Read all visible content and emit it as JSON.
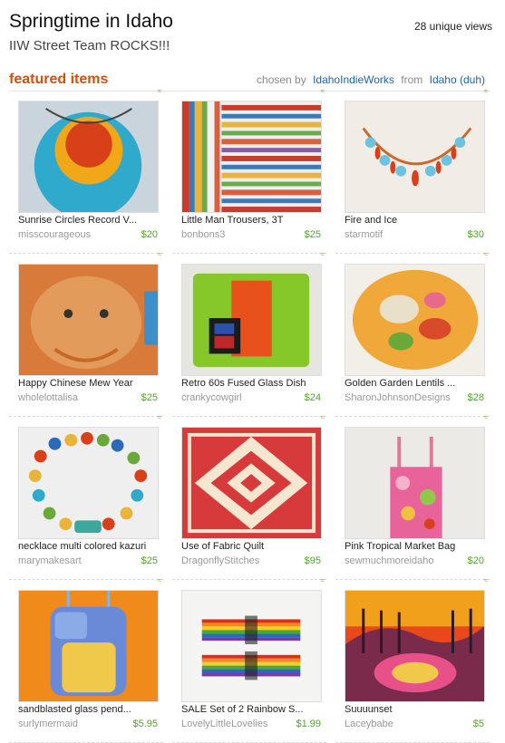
{
  "header": {
    "title": "Springtime in Idaho",
    "views": "28 unique views",
    "subtitle": "IIW Street Team ROCKS!!!"
  },
  "featured": {
    "label": "featured items",
    "chosen_by_prefix": "chosen by",
    "curator": "IdahoIndieWorks",
    "from_prefix": "from",
    "location": "Idaho (duh)"
  },
  "colors": {
    "accent": "#d54e0e",
    "link": "#1d63a6",
    "price": "#55a32a"
  },
  "items": [
    {
      "title": "Sunrise Circles  Record V...",
      "seller": "misscourageous",
      "price": "$20",
      "image": "orange-circle-on-teal-necklace"
    },
    {
      "title": "Little Man Trousers, 3T",
      "seller": "bonbons3",
      "price": "$25",
      "image": "striped-fabric"
    },
    {
      "title": "Fire and Ice",
      "seller": "starmotif",
      "price": "$30",
      "image": "bead-necklace"
    },
    {
      "title": "Happy Chinese Mew Year",
      "seller": "wholelottalisa",
      "price": "$25",
      "image": "knitted-cat"
    },
    {
      "title": "Retro 60s Fused Glass Dish",
      "seller": "crankycowgirl",
      "price": "$24",
      "image": "fused-glass-dish"
    },
    {
      "title": "Golden Garden Lentils ...",
      "seller": "SharonJohnsonDesigns",
      "price": "$28",
      "image": "lentil-bead"
    },
    {
      "title": "necklace multi colored kazuri",
      "seller": "marymakesart",
      "price": "$25",
      "image": "kazuri-bead-necklace"
    },
    {
      "title": "Use of Fabric Quilt",
      "seller": "DragonflyStitches",
      "price": "$95",
      "image": "red-quilt"
    },
    {
      "title": "Pink Tropical Market Bag",
      "seller": "sewmuchmoreidaho",
      "price": "$20",
      "image": "market-bag"
    },
    {
      "title": "sandblasted glass pend...",
      "seller": "surlymermaid",
      "price": "$5.95",
      "image": "glass-pendant"
    },
    {
      "title": "SALE Set of 2 Rainbow S...",
      "seller": "LovelyLittleLovelies",
      "price": "$1.99",
      "image": "rainbow-hair-clips"
    },
    {
      "title": "Suuuunset",
      "seller": "Laceybabe",
      "price": "$5",
      "image": "sunset-painting"
    }
  ]
}
